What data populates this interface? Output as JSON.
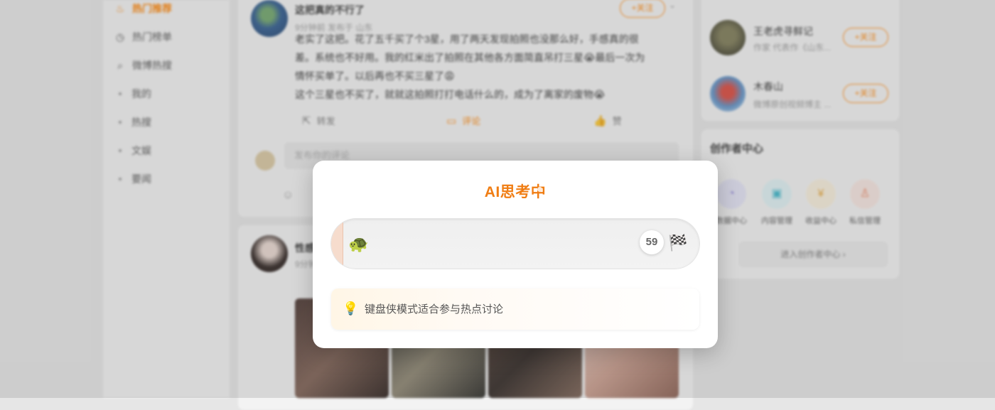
{
  "left_nav": {
    "items": [
      {
        "label": "热门推荐",
        "icon": "fire-icon",
        "active": true
      },
      {
        "label": "热门榜单",
        "icon": "clock-icon",
        "active": false
      },
      {
        "label": "微博热搜",
        "icon": "search-icon",
        "active": false
      },
      {
        "label": "我的",
        "icon": "dot",
        "active": false
      },
      {
        "label": "热搜",
        "icon": "dot",
        "active": false
      },
      {
        "label": "文娱",
        "icon": "dot",
        "active": false
      },
      {
        "label": "要闻",
        "icon": "dot",
        "active": false
      }
    ]
  },
  "feed": {
    "post1": {
      "name": "这把真的不行了",
      "meta": "9分钟前  发布于 山东",
      "follow": "+关注",
      "text_lines": [
        "老实了这把。花了五千买了个3星，用了两天发现拍照也没那么好，手感真的很",
        "差。系统也不好用。我的红米出了拍照在其他各方面简直吊打三星😭最后一次为",
        "情怀买单了。以后再也不买三星了😩",
        "这个三星也不买了，就就这拍照打打电话什么的，成为了离家的废物😭"
      ],
      "actions": {
        "repost": "转发",
        "comment": "评论",
        "like": "赞"
      },
      "comment_placeholder": "发布你的评论"
    },
    "post2": {
      "name": "性感",
      "meta": "9分钟"
    }
  },
  "sidebar": {
    "recommendations": [
      {
        "name": "王老虎寻鲜记",
        "desc": "作家 代表作《山东...",
        "follow": "+关注"
      },
      {
        "name": "木春山",
        "desc": "微博原创视频博主 ...",
        "follow": "+关注"
      }
    ],
    "creator": {
      "title": "创作者中心",
      "items": [
        "数据中心",
        "内容管理",
        "收益中心",
        "私信管理"
      ],
      "enter": "进入创作者中心"
    }
  },
  "dialog": {
    "title": "AI思考中",
    "countdown": "59",
    "progress": 0.03,
    "runner_icon": "🐢",
    "finish_icon": "🏁",
    "tip_icon": "💡",
    "tip": "键盘侠模式适合参与热点讨论"
  }
}
